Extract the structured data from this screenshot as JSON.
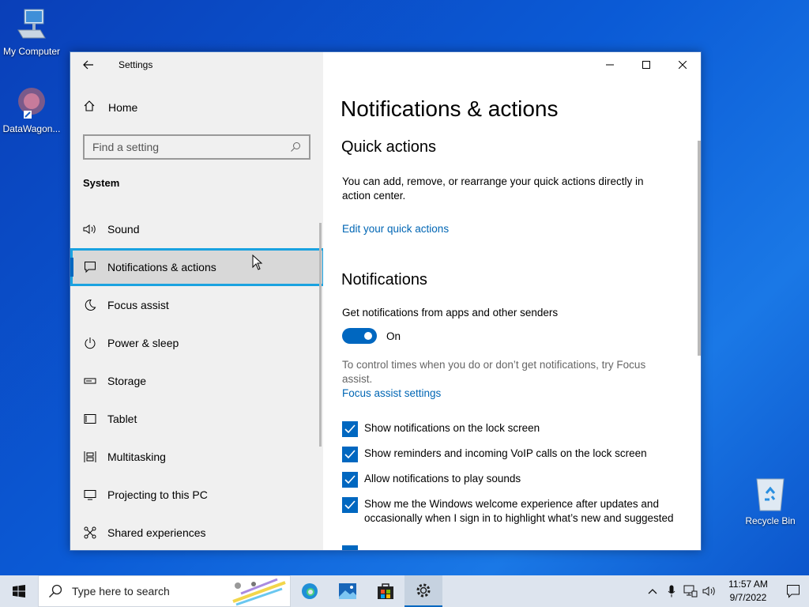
{
  "desktop": {
    "icons": [
      {
        "label": "My Computer"
      },
      {
        "label": "DataWagon..."
      },
      {
        "label": "Recycle Bin"
      }
    ]
  },
  "window": {
    "title": "Settings",
    "sidebar": {
      "home_label": "Home",
      "search_placeholder": "Find a setting",
      "section": "System",
      "items": [
        {
          "label": "Sound",
          "icon": "speaker-icon"
        },
        {
          "label": "Notifications & actions",
          "icon": "message-icon",
          "selected": true
        },
        {
          "label": "Focus assist",
          "icon": "moon-icon"
        },
        {
          "label": "Power & sleep",
          "icon": "power-icon"
        },
        {
          "label": "Storage",
          "icon": "storage-icon"
        },
        {
          "label": "Tablet",
          "icon": "tablet-icon"
        },
        {
          "label": "Multitasking",
          "icon": "multitasking-icon"
        },
        {
          "label": "Projecting to this PC",
          "icon": "projector-icon"
        },
        {
          "label": "Shared experiences",
          "icon": "share-icon"
        }
      ]
    },
    "content": {
      "page_title": "Notifications & actions",
      "quick_actions": {
        "heading": "Quick actions",
        "description": "You can add, remove, or rearrange your quick actions directly in action center.",
        "edit_link": "Edit your quick actions"
      },
      "notifications": {
        "heading": "Notifications",
        "get_label": "Get notifications from apps and other senders",
        "toggle_state": "On",
        "focus_hint": "To control times when you do or don’t get notifications, try Focus assist.",
        "focus_link": "Focus assist settings",
        "checkboxes": [
          {
            "label": "Show notifications on the lock screen",
            "checked": true
          },
          {
            "label": "Show reminders and incoming VoIP calls on the lock screen",
            "checked": true
          },
          {
            "label": "Allow notifications to play sounds",
            "checked": true
          },
          {
            "label": "Show me the Windows welcome experience after updates and occasionally when I sign in to highlight what’s new and suggested",
            "checked": true
          }
        ]
      }
    }
  },
  "taskbar": {
    "search_placeholder": "Type here to search",
    "apps": [
      "edge-icon",
      "photos-icon",
      "store-icon",
      "settings-icon"
    ],
    "clock_time": "11:57 AM",
    "clock_date": "9/7/2022"
  },
  "colors": {
    "accent": "#0067c0",
    "selection_outline": "#1aa2e0",
    "link": "#0066b4"
  }
}
